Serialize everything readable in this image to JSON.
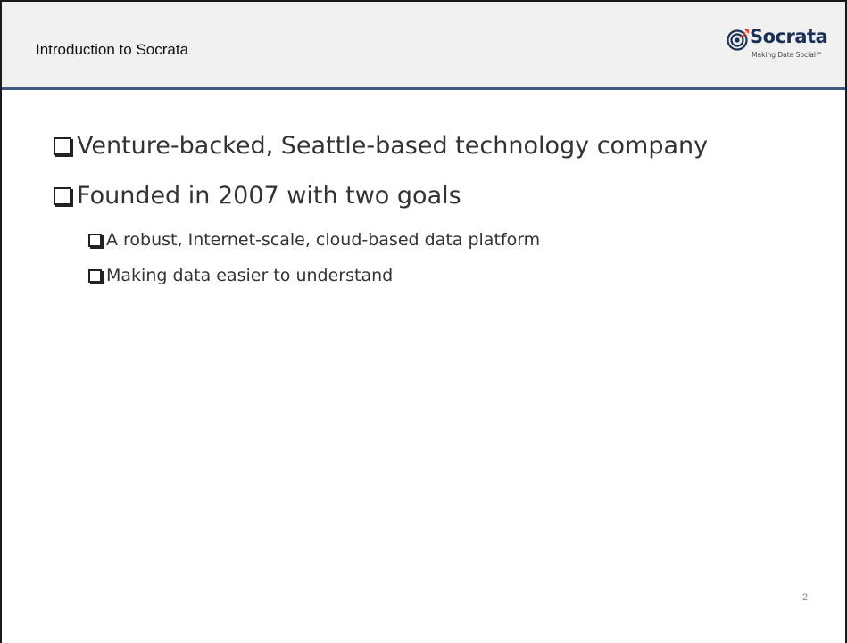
{
  "header": {
    "title": "Introduction to Socrata",
    "logo": {
      "name": "Socrata",
      "tagline": "Making Data Social™",
      "icon": "socrata-target-icon"
    }
  },
  "bullets": [
    {
      "level": 1,
      "text": "Venture-backed, Seattle-based technology company"
    },
    {
      "level": 1,
      "text": "Founded in 2007 with two goals"
    },
    {
      "level": 2,
      "text": "A robust, Internet-scale, cloud-based data platform"
    },
    {
      "level": 2,
      "text": "Making data easier to understand"
    }
  ],
  "footer": {
    "page_number": "2"
  },
  "colors": {
    "header_background": "#f0f0f0",
    "header_rule": "#3b5b86",
    "logo_brand": "#1b2f55",
    "logo_accent": "#e8442f"
  }
}
